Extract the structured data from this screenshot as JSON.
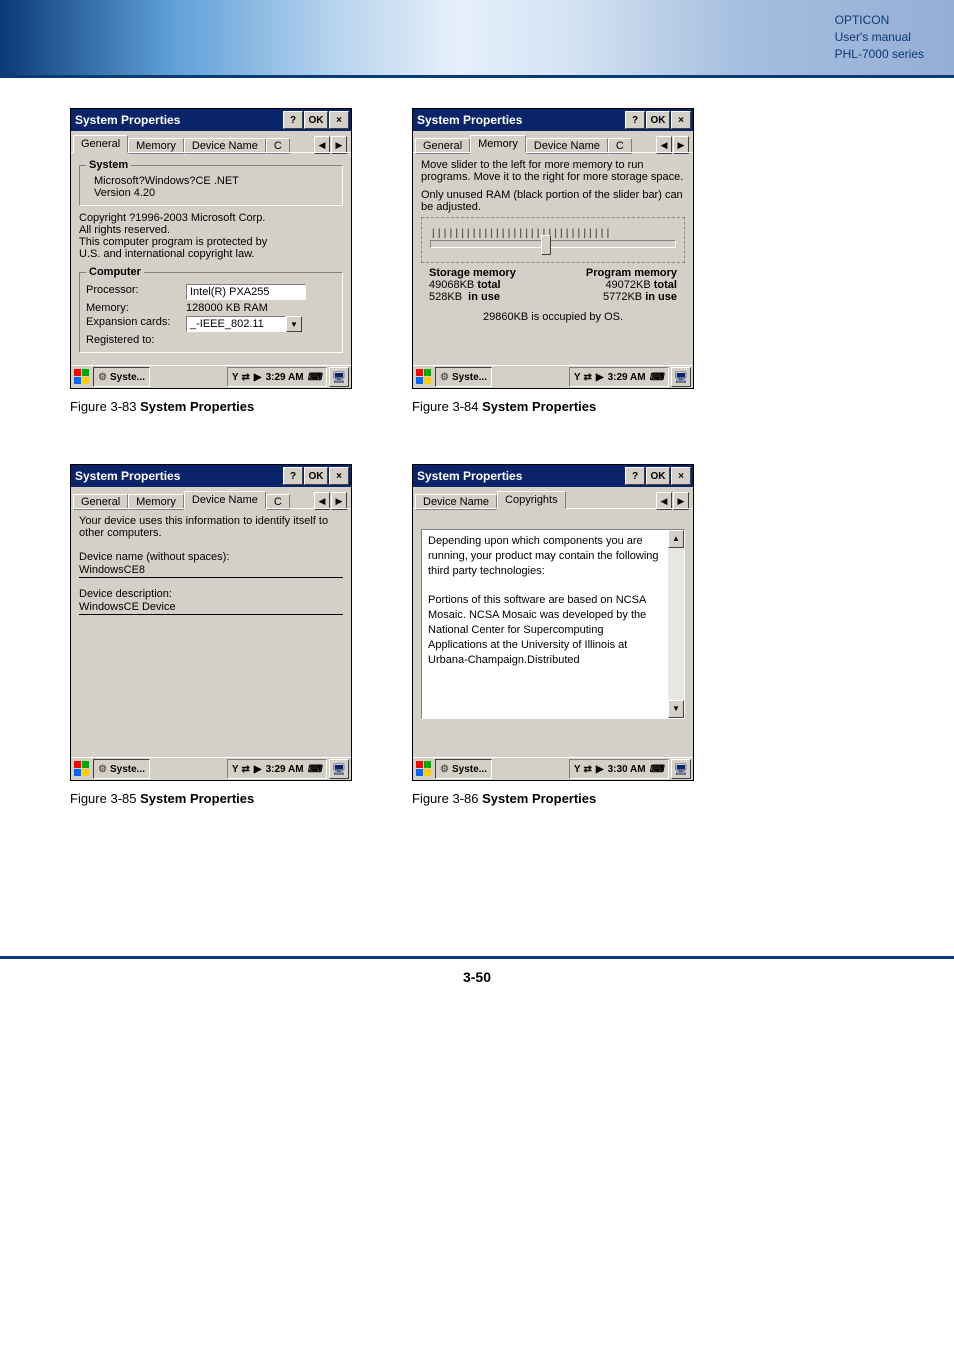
{
  "banner": {
    "line1": "OPTICON",
    "line2": "User's manual",
    "line3": "PHL-7000 series"
  },
  "page_number": "3-50",
  "captions": {
    "c1_prefix": "Figure 3-83 ",
    "c1_bold": "System Properties",
    "c2_prefix": "Figure 3-84 ",
    "c2_bold": "System Properties",
    "c3_prefix": "Figure 3-85 ",
    "c3_bold": "System Properties",
    "c4_prefix": "Figure 3-86 ",
    "c4_bold": "System Properties"
  },
  "common": {
    "window_title": "System Properties",
    "help": "?",
    "ok": "OK",
    "close": "×",
    "task_label": "Syste...",
    "tray_arrow": "▶",
    "desktop_tooltip": "🖥",
    "scroll_left": "◀",
    "scroll_right": "▶",
    "dd_arrow": "▼",
    "scroll_up": "▲",
    "scroll_down": "▼"
  },
  "tabs": {
    "general": "General",
    "memory": "Memory",
    "device_name": "Device Name",
    "copyrights": "Copyrights"
  },
  "fig83": {
    "tray_time": "3:29 AM",
    "system_legend": "System",
    "os_line": "Microsoft?Windows?CE .NET",
    "version_line": "Version 4.20",
    "copyright1": "Copyright ?1996-2003 Microsoft Corp.",
    "copyright2": "All rights reserved.",
    "copyright3": "This computer program is protected by",
    "copyright4": "U.S. and international copyright law.",
    "computer_legend": "Computer",
    "processor_label": "Processor:",
    "processor_value": "Intel(R) PXA255",
    "memory_label": "Memory:",
    "memory_value": "128000 KB  RAM",
    "expansion_label": "Expansion cards:",
    "expansion_value": "_-IEEE_802.11",
    "registered_label": "Registered to:"
  },
  "fig84": {
    "tray_time": "3:29 AM",
    "instr1": "Move slider to the left for more memory to run programs. Move it to the right for more storage space.",
    "instr2": "Only unused RAM (black portion of the slider bar) can be adjusted.",
    "storage_hdr": "Storage memory",
    "program_hdr": "Program memory",
    "storage_total_val": "49068KB",
    "program_total_val": "49072KB",
    "total_label": "total",
    "storage_inuse_val": "528KB",
    "program_inuse_val": "5772KB",
    "inuse_label": "in use",
    "os_line": "29860KB is occupied by OS."
  },
  "fig85": {
    "tray_time": "3:29 AM",
    "intro": "Your device uses this information to identify itself to other computers.",
    "name_label": "Device name (without spaces):",
    "name_value": "WindowsCE8",
    "desc_label": "Device description:",
    "desc_value": "WindowsCE Device"
  },
  "fig86": {
    "tray_time": "3:30 AM",
    "para1": "Depending upon which components you are running, your product may contain the following third party technologies:",
    "para2": "Portions of this software are based on NCSA Mosaic. NCSA Mosaic was developed by the National Center for Supercomputing Applications at the University of Illinois at Urbana-Champaign.Distributed"
  }
}
